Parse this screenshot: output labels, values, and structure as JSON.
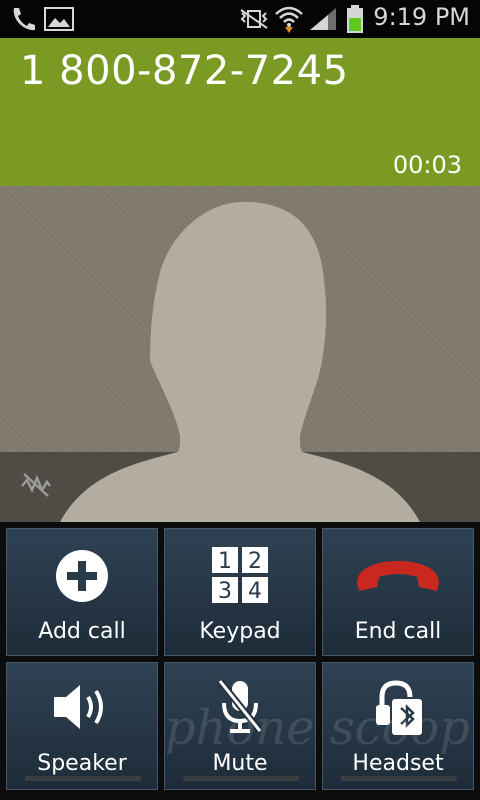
{
  "status_bar": {
    "time": "9:19 PM",
    "icons": [
      "phone-call-icon",
      "gallery-icon",
      "vibrate-mute-icon",
      "wifi-icon",
      "signal-icon",
      "battery-icon"
    ]
  },
  "call": {
    "number": "1 800-872-7245",
    "timer": "00:03"
  },
  "buttons": {
    "add_call": "Add call",
    "keypad": "Keypad",
    "end_call": "End call",
    "speaker": "Speaker",
    "mute": "Mute",
    "headset": "Headset"
  },
  "keypad_digits": [
    "1",
    "2",
    "3",
    "4"
  ],
  "colors": {
    "header_green": "#7b9a23",
    "end_call_red": "#c8281e",
    "button_blue": "#2f4253"
  },
  "watermark": "phone scoop"
}
